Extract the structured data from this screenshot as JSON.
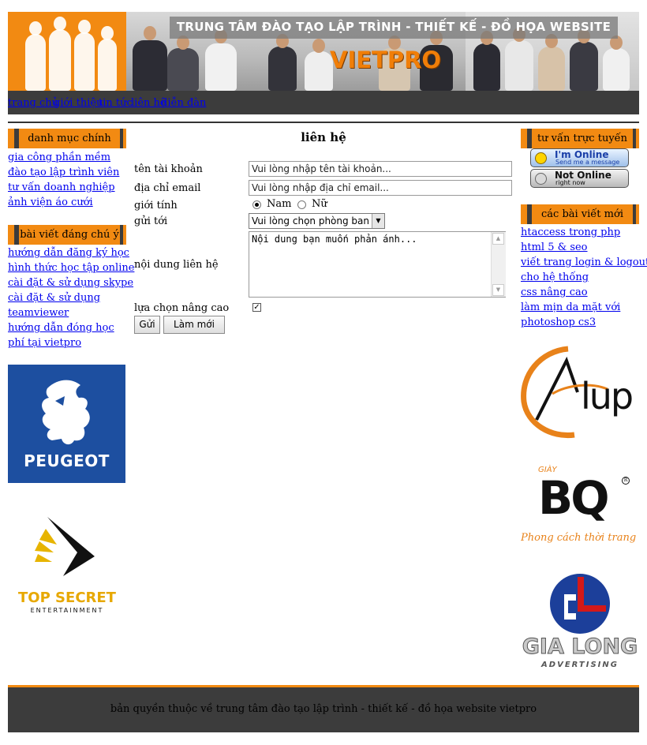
{
  "banner": {
    "title": "TRUNG TÂM ĐÀO TẠO LẬP TRÌNH - THIẾT KẾ - ĐỒ HỌA WEBSITE",
    "brand": "VIETPRO",
    "brand_color": "#f07e08"
  },
  "nav": {
    "items": [
      "trang chủ",
      "giới thiệu",
      "tin tức",
      "liên hệ",
      "diễn đàn"
    ]
  },
  "left": {
    "main_header": "danh mục chính",
    "main_links": [
      "gia công phần mềm",
      "đào tạo lập trình viên",
      "tư vấn doanh nghiệp",
      "ảnh viện áo cưới"
    ],
    "featured_header": "bài viết đáng chú ý",
    "featured_links": [
      "hướng dẫn đăng ký học",
      "hình thức học tập online",
      "cài đặt & sử dụng skype",
      "cài đặt & sử dụng teamviewer",
      "hướng dẫn đóng học phí tại vietpro"
    ],
    "logo1": "PEUGEOT",
    "logo2_line1": "TOP SECRET",
    "logo2_line2": "ENTERTAINMENT"
  },
  "form": {
    "title": "liên hệ",
    "account_label": "tên tài khoản",
    "account_placeholder": "Vui lòng nhập tên tài khoản...",
    "email_label": "địa chỉ email",
    "email_placeholder": "Vui lòng nhập địa chỉ email...",
    "gender_label": "giới tính",
    "gender_male": "Nam",
    "gender_female": "Nữ",
    "gender_selected": "Nam",
    "send_to_label": "gửi tới",
    "send_to_value": "Vui lòng chọn phòng ban",
    "content_label": "nội dung liên hệ",
    "content_placeholder": "Nội dung bạn muốn phản ánh...",
    "advanced_label": "lựa chọn nâng cao",
    "advanced_checked": true,
    "submit_label": "Gửi",
    "reset_label": "Làm mới"
  },
  "right": {
    "support_header": "tư vấn trực tuyến",
    "online_title": "I'm Online",
    "online_sub": "Send me a message",
    "offline_title": "Not Online",
    "offline_sub": "right now",
    "recent_header": "các bài viết mới",
    "recent_links": [
      "htaccess trong php",
      "html 5 & seo",
      "viết trang login & logout",
      "cho hệ thống",
      "css nâng cao",
      "làm mịn da mặt với",
      "photoshop cs3"
    ],
    "logo_alup": "lup",
    "logo_bq_small": "GIÀY",
    "logo_bq": "BQ",
    "logo_bq_slogan": "Phong cách thời trang da",
    "logo_gialong": "GIA LONG",
    "logo_gialong_sub": "ADVERTISING"
  },
  "footer": {
    "text": "bản quyền thuộc về trung tâm đào tạo lập trình - thiết kế - đồ họa website vietpro"
  },
  "colors": {
    "accent": "#f28a12",
    "dark_bar": "#3c3c3c",
    "link": "#0000ee"
  }
}
